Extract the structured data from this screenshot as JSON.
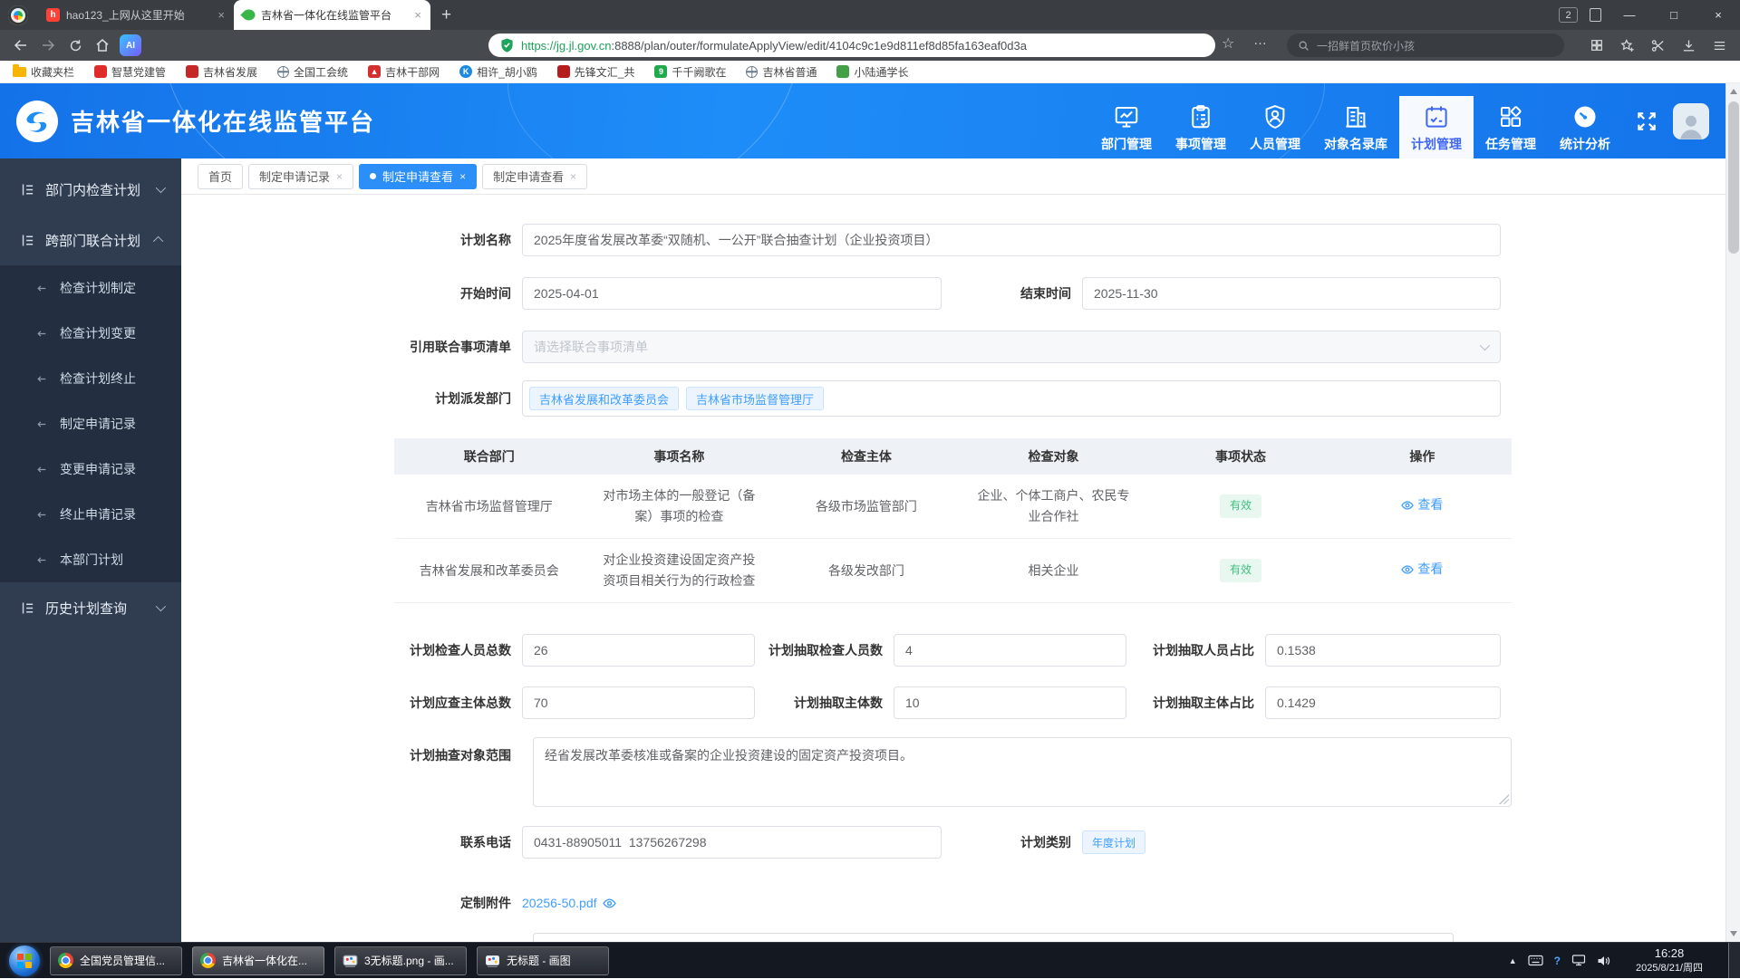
{
  "ui": {
    "close_glyph": "×",
    "minimize_glyph": "—",
    "maximize_glyph": "□",
    "newtab_glyph": "+",
    "star_glyph": "☆",
    "more_glyph": "…",
    "caret_up_glyph": "▲",
    "question_glyph": "?"
  },
  "browser": {
    "tabs": [
      {
        "title": "hao123_上网从这里开始"
      },
      {
        "title": "吉林省一体化在线监管平台"
      }
    ],
    "tab_badge_count": "2",
    "url_scheme_host": "https://jg.jl.gov.cn",
    "url_rest": ":8888/plan/outer/formulateApplyView/edit/4104c9c1e9d811ef8d85fa163eaf0d3a",
    "search_placeholder": "一招鲜首页砍价小孩",
    "bookmarks": [
      {
        "label": "收藏夹栏",
        "color": "#f7b500"
      },
      {
        "label": "智慧党建管",
        "color": "#e02b2b"
      },
      {
        "label": "吉林省发展",
        "color": "#c62828"
      },
      {
        "label": "全国工会统",
        "color": "#6b7a89"
      },
      {
        "label": "吉林干部网",
        "color": "#d32f2f"
      },
      {
        "label": "相许_胡小鸥",
        "color": "#1e88e5",
        "glyph": "K"
      },
      {
        "label": "先锋文汇_共",
        "color": "#b71c1c"
      },
      {
        "label": "千千阙歌在",
        "color": "#21a94e",
        "glyph": "9"
      },
      {
        "label": "吉林省普通",
        "color": "#6b7a89"
      },
      {
        "label": "小陆通学长",
        "color": "#43a047"
      }
    ]
  },
  "header": {
    "title": "吉林省一体化在线监管平台",
    "nav": [
      {
        "label": "部门管理"
      },
      {
        "label": "事项管理"
      },
      {
        "label": "人员管理"
      },
      {
        "label": "对象名录库"
      },
      {
        "label": "计划管理",
        "active": true
      },
      {
        "label": "任务管理"
      },
      {
        "label": "统计分析"
      }
    ],
    "active_color": "#4066f5",
    "blue": "#1e8df8"
  },
  "sidebar": {
    "items": [
      {
        "label": "部门内检查计划",
        "expanded": false
      },
      {
        "label": "跨部门联合计划",
        "expanded": true,
        "children": [
          "检查计划制定",
          "检查计划变更",
          "检查计划终止",
          "制定申请记录",
          "变更申请记录",
          "终止申请记录",
          "本部门计划"
        ]
      },
      {
        "label": "历史计划查询",
        "expanded": false
      }
    ]
  },
  "page_tabs": [
    {
      "label": "首页",
      "closable": false
    },
    {
      "label": "制定申请记录",
      "closable": true
    },
    {
      "label": "制定申请查看",
      "closable": true,
      "active": true
    },
    {
      "label": "制定申请查看",
      "closable": true
    }
  ],
  "form": {
    "plan_name": {
      "label": "计划名称",
      "value": "2025年度省发展改革委“双随机、一公开”联合抽查计划（企业投资项目）"
    },
    "start_time": {
      "label": "开始时间",
      "value": "2025-04-01"
    },
    "end_time": {
      "label": "结束时间",
      "value": "2025-11-30"
    },
    "ref_list": {
      "label": "引用联合事项清单",
      "placeholder": "请选择联合事项清单"
    },
    "dispatch": {
      "label": "计划派发部门",
      "tags": [
        "吉林省发展和改革委员会",
        "吉林省市场监督管理厅"
      ]
    },
    "stats": {
      "total_inspectors": {
        "label": "计划检查人员总数",
        "value": "26"
      },
      "sampled_inspectors": {
        "label": "计划抽取检查人员数",
        "value": "4"
      },
      "inspector_ratio": {
        "label": "计划抽取人员占比",
        "value": "0.1538"
      },
      "total_subjects": {
        "label": "计划应查主体总数",
        "value": "70"
      },
      "sampled_subjects": {
        "label": "计划抽取主体数",
        "value": "10"
      },
      "subject_ratio": {
        "label": "计划抽取主体占比",
        "value": "0.1429"
      }
    },
    "scope": {
      "label": "计划抽查对象范围",
      "value": "经省发展改革委核准或备案的企业投资建设的固定资产投资项目。"
    },
    "phone": {
      "label": "联系电话",
      "value": "0431-88905011  13756267298"
    },
    "category": {
      "label": "计划类别",
      "tag": "年度计划"
    },
    "attachment": {
      "label": "定制附件",
      "file": "20256-50.pdf"
    }
  },
  "items_table": {
    "headers": [
      "联合部门",
      "事项名称",
      "检查主体",
      "检查对象",
      "事项状态",
      "操作"
    ],
    "rows": [
      {
        "dept": "吉林省市场监督管理厅",
        "item": "对市场主体的一般登记（备案）事项的检查",
        "subject": "各级市场监管部门",
        "target": "企业、个体工商户、农民专业合作社",
        "status": "有效",
        "action": "查看"
      },
      {
        "dept": "吉林省发展和改革委员会",
        "item": "对企业投资建设固定资产投资项目相关行为的行政检查",
        "subject": "各级发改部门",
        "target": "相关企业",
        "status": "有效",
        "action": "查看"
      }
    ],
    "status_color": "#3fbf7f",
    "link_color": "#409eff"
  },
  "taskbar": {
    "buttons": [
      {
        "label": "全国党员管理信..."
      },
      {
        "label": "吉林省一体化在..."
      },
      {
        "label": "3无标题.png - 画..."
      },
      {
        "label": "无标题 - 画图"
      }
    ],
    "clock": {
      "time": "16:28",
      "date": "2025/8/21/周四"
    }
  }
}
